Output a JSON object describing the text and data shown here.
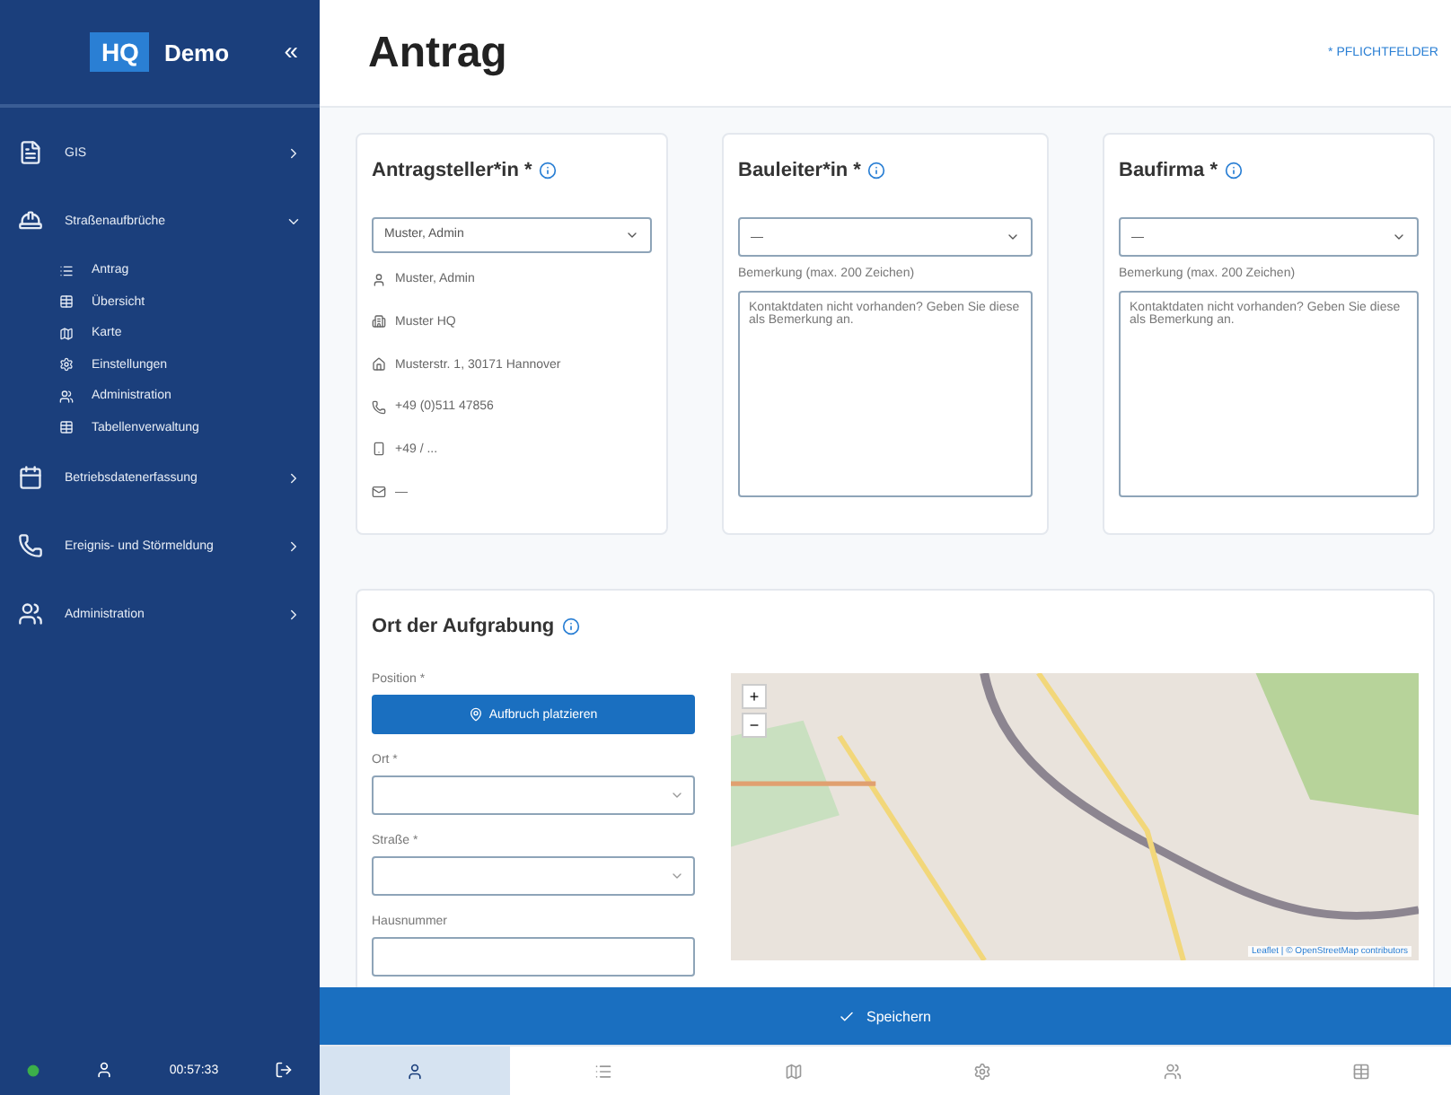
{
  "sidebar": {
    "logo_badge": "HQ",
    "logo_text": "Demo",
    "collapse": "«",
    "items": [
      {
        "label": "GIS",
        "expanded": false
      },
      {
        "label": "Straßenaufbrüche",
        "expanded": true,
        "children": [
          {
            "label": "Antrag"
          },
          {
            "label": "Übersicht"
          },
          {
            "label": "Karte"
          },
          {
            "label": "Einstellungen"
          },
          {
            "label": "Administration"
          },
          {
            "label": "Tabellenverwaltung"
          }
        ]
      },
      {
        "label": "Betriebsdatenerfassung",
        "expanded": false
      },
      {
        "label": "Ereignis- und Störmeldung",
        "expanded": false
      },
      {
        "label": "Administration",
        "expanded": false
      }
    ]
  },
  "header": {
    "title": "Antrag",
    "required_note": "* PFLICHTFELDER"
  },
  "cards": [
    {
      "kind": "person",
      "title": "Antragsteller*in *",
      "select_value": "Muster, Admin",
      "details": [
        "Muster, Admin",
        "Muster HQ",
        "Musterstr. 1, 30171 Hannover",
        "+49 (0)511 47856",
        "+49 / ...",
        "—"
      ]
    },
    {
      "kind": "remark",
      "title": "Bauleiter*in *",
      "select_value": "—",
      "remark_label": "Bemerkung (max. 200 Zeichen)",
      "remark_placeholder": "Kontaktdaten nicht vorhanden? Geben Sie diese als Bemerkung an."
    },
    {
      "kind": "remark",
      "title": "Baufirma *",
      "select_value": "—",
      "remark_label": "Bemerkung (max. 200 Zeichen)",
      "remark_placeholder": "Kontaktdaten nicht vorhanden? Geben Sie diese als Bemerkung an."
    }
  ],
  "location": {
    "title": "Ort der Aufgrabung",
    "position_label": "Position *",
    "place_button": "Aufbruch platzieren",
    "fields": [
      {
        "label": "Ort *",
        "kind": "select"
      },
      {
        "label": "Straße *",
        "kind": "select"
      },
      {
        "label": "Hausnummer",
        "kind": "text"
      }
    ],
    "map": {
      "zoom_in": "+",
      "zoom_out": "−",
      "attribution": "Leaflet | © OpenStreetMap contributors"
    }
  },
  "save_button": "Speichern",
  "status": {
    "online": true,
    "time": "00:57:33"
  },
  "bottom_tabs": [
    {
      "selected": true
    },
    {
      "selected": false
    },
    {
      "selected": false
    },
    {
      "selected": false
    },
    {
      "selected": false
    },
    {
      "selected": false
    }
  ]
}
